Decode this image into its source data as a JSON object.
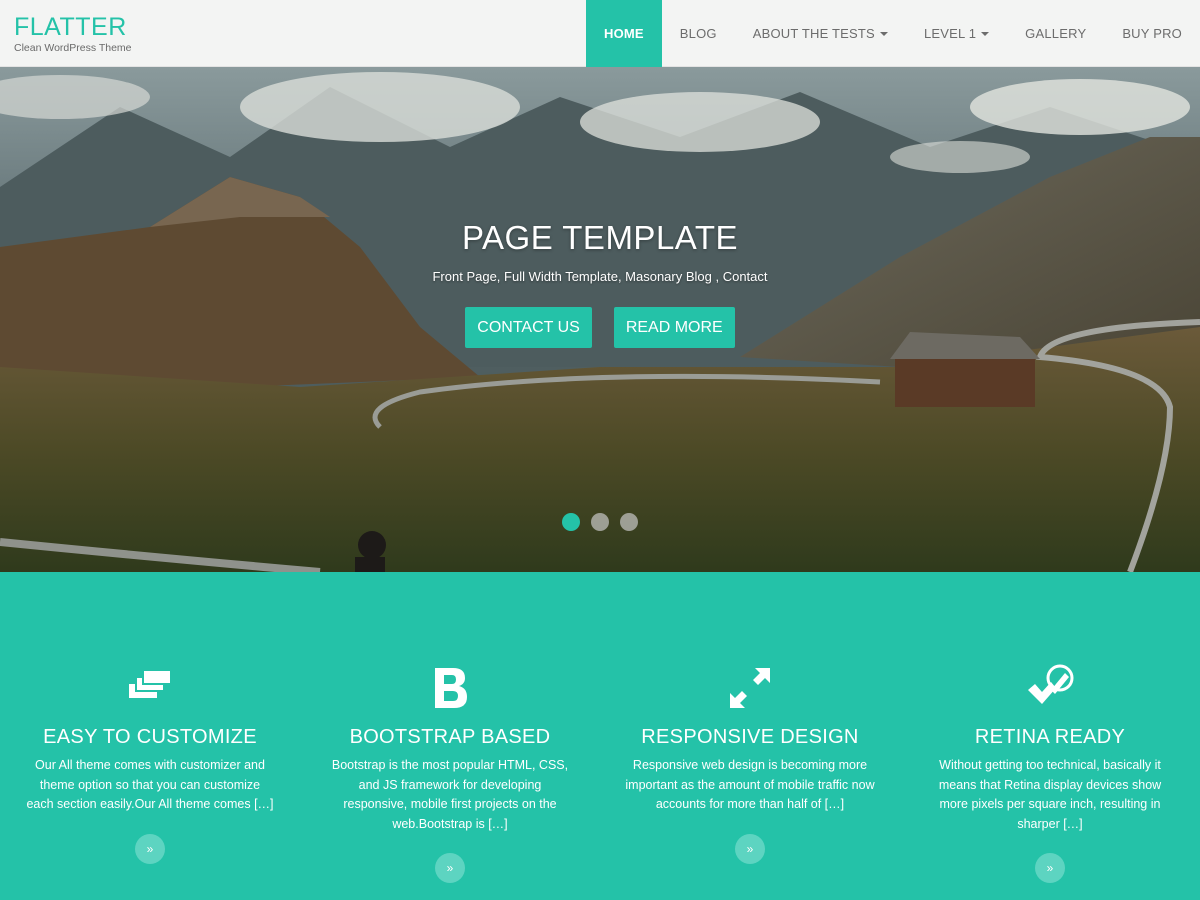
{
  "header": {
    "brand_title": "FLATTER",
    "brand_tagline": "Clean WordPress Theme",
    "nav": [
      {
        "label": "HOME",
        "active": true,
        "dropdown": false
      },
      {
        "label": "BLOG",
        "active": false,
        "dropdown": false
      },
      {
        "label": "ABOUT THE TESTS",
        "active": false,
        "dropdown": true
      },
      {
        "label": "LEVEL 1",
        "active": false,
        "dropdown": true
      },
      {
        "label": "GALLERY",
        "active": false,
        "dropdown": false
      },
      {
        "label": "BUY PRO",
        "active": false,
        "dropdown": false
      }
    ]
  },
  "hero": {
    "title": "PAGE TEMPLATE",
    "subtitle": "Front Page, Full Width Template, Masonary Blog , Contact",
    "contact_button": "CONTACT US",
    "read_more_button": "READ MORE",
    "slides_total": 3,
    "active_slide": 1
  },
  "features": [
    {
      "icon": "layers-icon",
      "title": "EASY TO CUSTOMIZE",
      "description": "Our All theme comes with customizer and theme option so that you can customize each section easily.Our All theme comes […]"
    },
    {
      "icon": "bootstrap-b-icon",
      "title": "BOOTSTRAP BASED",
      "description": "Bootstrap is the most popular HTML, CSS, and JS framework for developing responsive, mobile first projects on the web.Bootstrap is […]"
    },
    {
      "icon": "expand-arrows-icon",
      "title": "RESPONSIVE DESIGN",
      "description": "Responsive web design is becoming more important as the amount of mobile traffic now accounts for more than half of […]"
    },
    {
      "icon": "check-pencil-icon",
      "title": "RETINA READY",
      "description": "Without getting too technical, basically it means that Retina display devices show more pixels per square inch, resulting in sharper […]"
    }
  ],
  "more_glyph": "»",
  "colors": {
    "accent": "#24c2a8",
    "header_bg": "#f3f4f3",
    "nav_text": "#6c6c6c",
    "more_button": "#5dd4c1"
  }
}
